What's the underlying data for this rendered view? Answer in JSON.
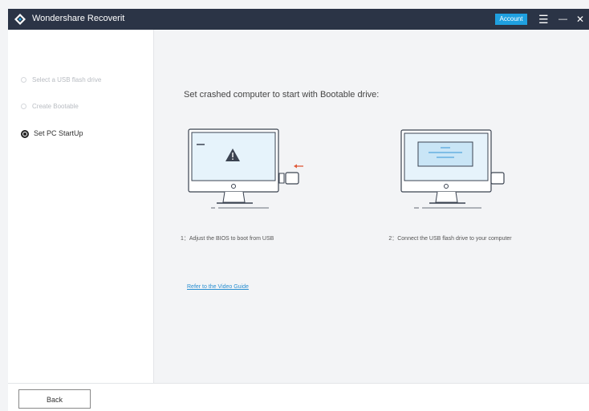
{
  "app": {
    "title": "Wondershare Recoverit",
    "account_label": "Account",
    "menu_glyph": "☰",
    "minimize_glyph": "—",
    "close_glyph": "✕"
  },
  "sidebar": {
    "steps": [
      {
        "label": "Select a USB flash drive",
        "state": "inactive"
      },
      {
        "label": "Create Bootable",
        "state": "inactive"
      },
      {
        "label": "Set PC StartUp",
        "state": "active"
      }
    ]
  },
  "main": {
    "heading": "Set crashed computer to start with Bootable drive:",
    "steps": [
      {
        "caption": "1：Adjust the BIOS to boot from USB",
        "illustration": "monitor-warning-usb-icon"
      },
      {
        "caption": "2：Connect the USB flash drive to your computer",
        "illustration": "monitor-usb-connected-icon"
      }
    ],
    "video_link": "Refer to the Video Guide"
  },
  "footer": {
    "back_label": "Back"
  },
  "colors": {
    "titlebar": "#2b3446",
    "accent": "#1fa0e0",
    "screen_fill": "#e6f3fb",
    "illus_stroke": "#3b4351",
    "arrow": "#e05a3a",
    "link": "#2a8fd1"
  }
}
